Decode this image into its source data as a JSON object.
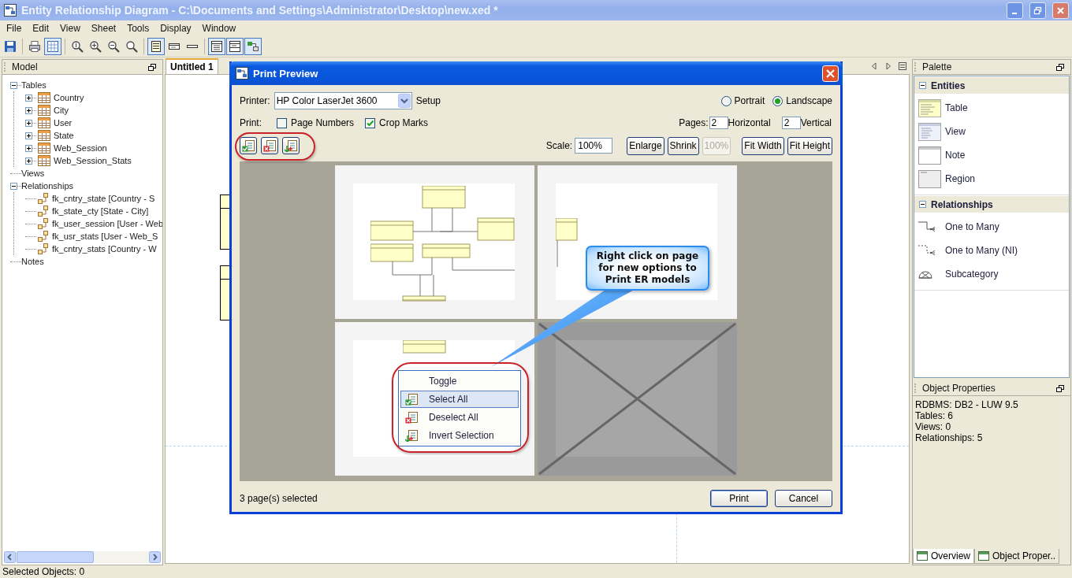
{
  "window": {
    "title": "Entity Relationship Diagram - C:\\Documents and Settings\\Administrator\\Desktop\\new.xed *"
  },
  "menu": [
    "File",
    "Edit",
    "View",
    "Sheet",
    "Tools",
    "Display",
    "Window"
  ],
  "toolbar": [
    [
      {
        "kind": "save",
        "selected": false
      }
    ],
    [
      {
        "kind": "print",
        "selected": false
      },
      {
        "kind": "grid",
        "selected": true
      }
    ],
    [
      {
        "kind": "zoom-actual",
        "selected": false
      },
      {
        "kind": "zoom-in",
        "selected": false
      },
      {
        "kind": "zoom-out",
        "selected": false
      },
      {
        "kind": "zoom-fit",
        "selected": false
      }
    ],
    [
      {
        "kind": "detail",
        "selected": true
      },
      {
        "kind": "compact",
        "selected": false
      },
      {
        "kind": "line",
        "selected": false
      }
    ],
    [
      {
        "kind": "layout-a",
        "selected": true
      },
      {
        "kind": "layout-b",
        "selected": true
      },
      {
        "kind": "diagram",
        "selected": true
      }
    ]
  ],
  "model_panel": {
    "title": "Model",
    "tree": [
      {
        "label": "Tables",
        "expanded": true,
        "children": [
          {
            "label": "Country",
            "kind": "table",
            "expanded": false
          },
          {
            "label": "City",
            "kind": "table",
            "expanded": false
          },
          {
            "label": "User",
            "kind": "table",
            "expanded": false
          },
          {
            "label": "State",
            "kind": "table",
            "expanded": false
          },
          {
            "label": "Web_Session",
            "kind": "table",
            "expanded": false
          },
          {
            "label": "Web_Session_Stats",
            "kind": "table",
            "expanded": false
          }
        ]
      },
      {
        "label": "Views"
      },
      {
        "label": "Relationships",
        "expanded": true,
        "children": [
          {
            "label": "fk_cntry_state [Country - S",
            "kind": "relationship"
          },
          {
            "label": "fk_state_cty [State - City]",
            "kind": "relationship"
          },
          {
            "label": "fk_user_session [User - Web",
            "kind": "relationship"
          },
          {
            "label": "fk_usr_stats [User - Web_S",
            "kind": "relationship"
          },
          {
            "label": "fk_cntry_stats [Country - W",
            "kind": "relationship"
          }
        ]
      },
      {
        "label": "Notes"
      }
    ]
  },
  "editor": {
    "tabs": [
      {
        "label": "Untitled 1",
        "selected": true
      }
    ]
  },
  "print_preview": {
    "title": "Print Preview",
    "printer_label": "Printer:",
    "printer": "HP Color LaserJet 3600",
    "setup": "Setup",
    "orientation": [
      {
        "label": "Portrait",
        "selected": false
      },
      {
        "label": "Landscape",
        "selected": true
      }
    ],
    "print_label": "Print:",
    "print_options": [
      {
        "label": "Page Numbers",
        "checked": false
      },
      {
        "label": "Crop Marks",
        "checked": true
      }
    ],
    "pages_label": "Pages:",
    "pages_horizontal": "2",
    "horizontal_label": "Horizontal",
    "pages_vertical": "2",
    "vertical_label": "Vertical",
    "selection_buttons": [
      {
        "kind": "select-all"
      },
      {
        "kind": "deselect-all"
      },
      {
        "kind": "invert"
      }
    ],
    "scale_label": "Scale:",
    "scale": "100%",
    "zoom_buttons": [
      {
        "label": "Enlarge",
        "disabled": false
      },
      {
        "label": "Shrink",
        "disabled": false
      },
      {
        "label": "100%",
        "disabled": true
      },
      {
        "label": "Fit Width",
        "disabled": false
      },
      {
        "label": "Fit Height",
        "disabled": false
      }
    ],
    "pages": [
      {
        "selected": true
      },
      {
        "selected": true
      },
      {
        "selected": true
      },
      {
        "selected": false
      }
    ],
    "context_menu": [
      {
        "label": "Toggle",
        "kind": "toggle",
        "selected": false
      },
      {
        "label": "Select All",
        "kind": "select-all",
        "selected": true
      },
      {
        "label": "Deselect All",
        "kind": "deselect-all",
        "selected": false
      },
      {
        "label": "Invert Selection",
        "kind": "invert",
        "selected": false
      }
    ],
    "callout": "Right click on page for new options to Print ER models",
    "status": "3 page(s) selected",
    "buttons": [
      {
        "label": "Print",
        "default": true
      },
      {
        "label": "Cancel",
        "default": false
      }
    ]
  },
  "palette": {
    "title": "Palette",
    "sections": [
      {
        "label": "Entities",
        "expanded": true,
        "items": [
          {
            "label": "Table",
            "kind": "table"
          },
          {
            "label": "View",
            "kind": "view"
          },
          {
            "label": "Note",
            "kind": "note"
          },
          {
            "label": "Region",
            "kind": "region"
          }
        ]
      },
      {
        "label": "Relationships",
        "expanded": true,
        "items": [
          {
            "label": "One to Many",
            "kind": "one-to-many"
          },
          {
            "label": "One to Many (NI)",
            "kind": "one-to-many-ni"
          },
          {
            "label": "Subcategory",
            "kind": "subcategory"
          }
        ]
      }
    ]
  },
  "object_properties": {
    "title": "Object Properties",
    "lines": [
      "RDBMS: DB2 - LUW 9.5",
      "Tables: 6",
      "Views: 0",
      "Relationships: 5"
    ]
  },
  "bottom_tabs": [
    {
      "label": "Overview",
      "selected": true
    },
    {
      "label": "Object Proper..",
      "selected": false
    }
  ],
  "status_bar": "Selected Objects: 0"
}
